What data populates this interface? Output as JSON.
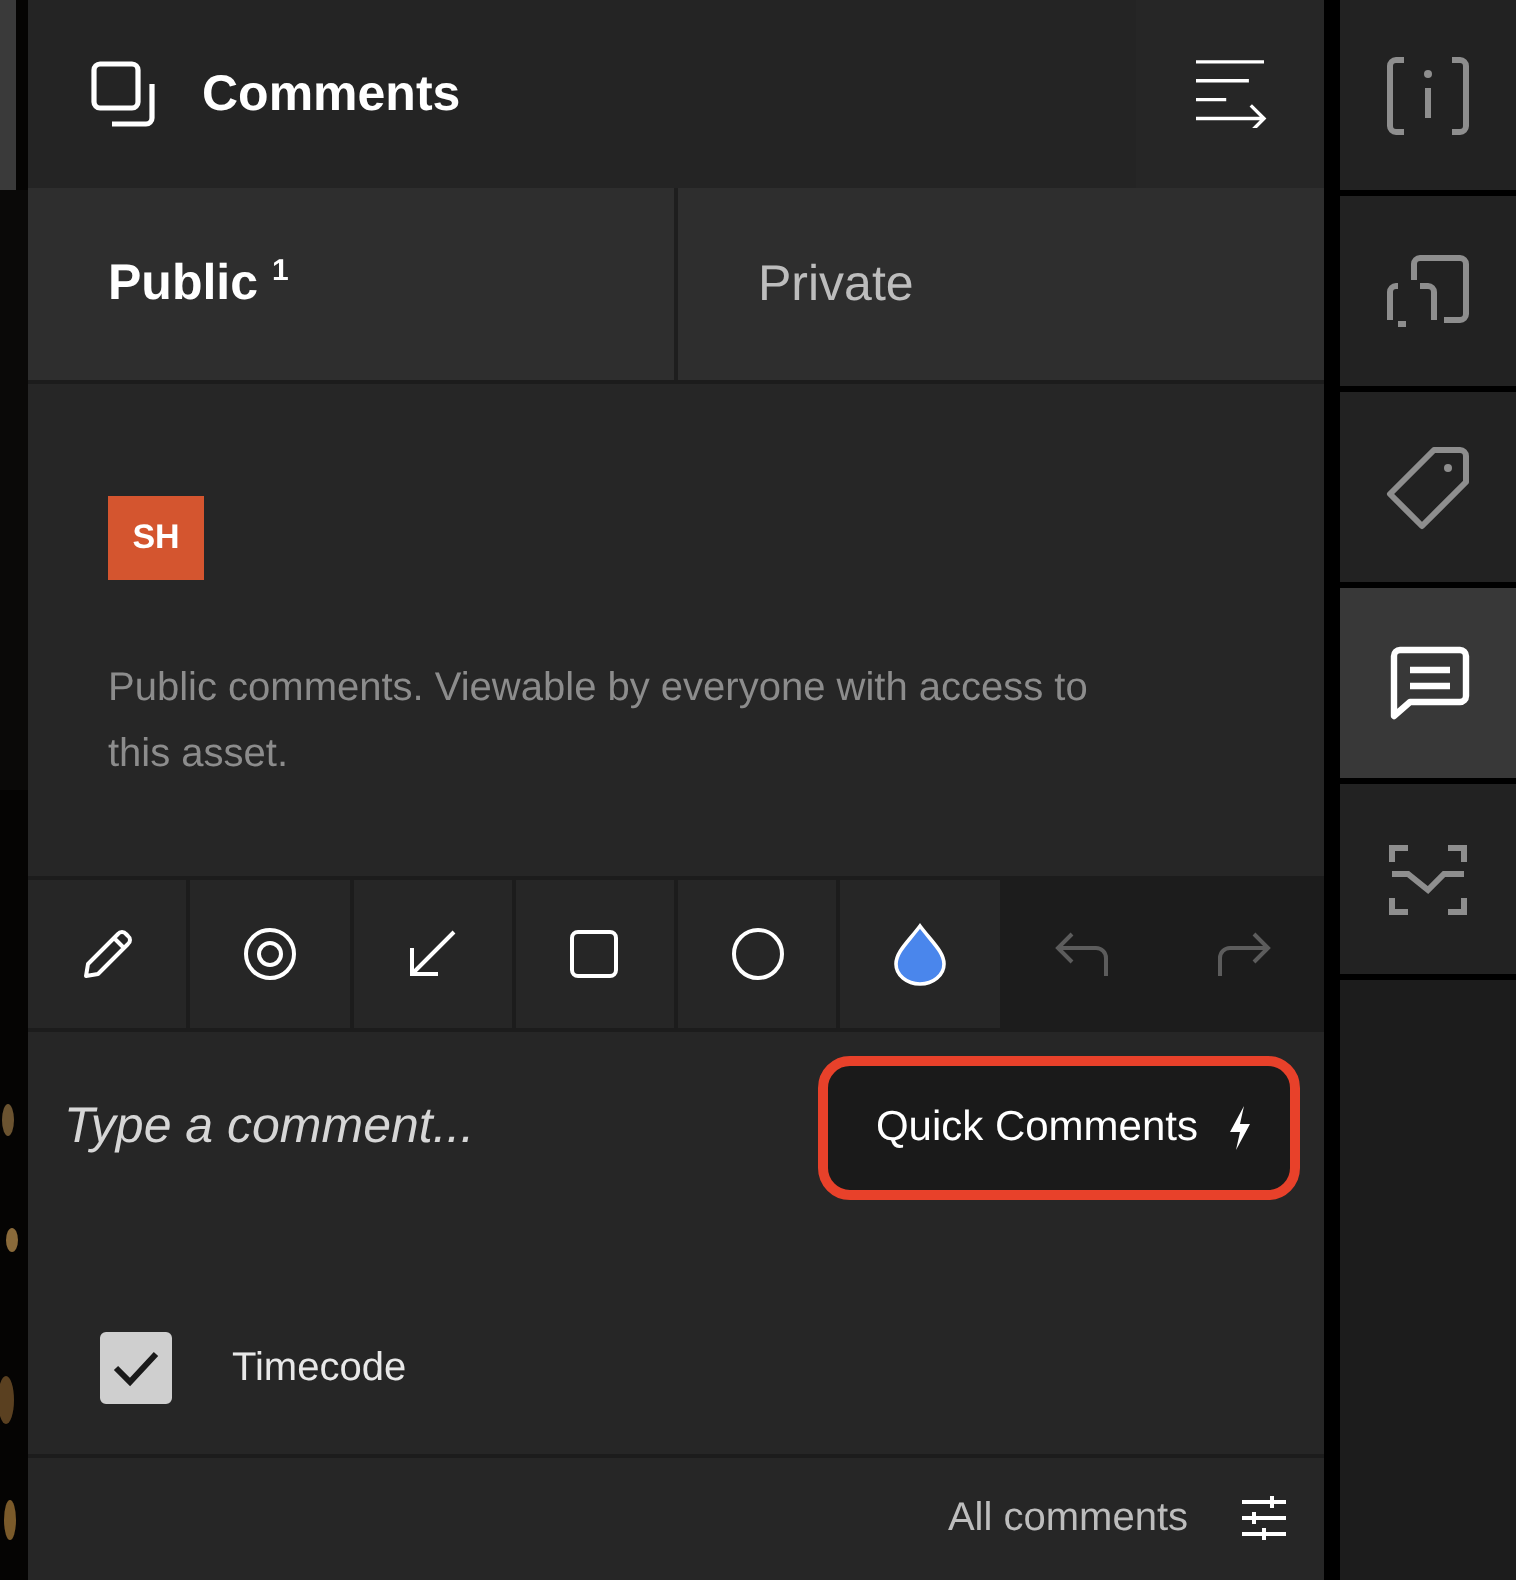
{
  "header": {
    "title": "Comments"
  },
  "tabs": [
    {
      "label": "Public $^{1}$",
      "selected": true
    },
    {
      "label": "Private",
      "selected": false
    }
  ],
  "author": {
    "initials": "SH"
  },
  "note": "Public comments. Viewable by everyone with access to this asset.",
  "tools": [
    {
      "kind": "pencil",
      "disabled": false
    },
    {
      "kind": "target",
      "disabled": false
    },
    {
      "kind": "arrow",
      "disabled": false
    },
    {
      "kind": "rectangle",
      "disabled": false
    },
    {
      "kind": "ellipse",
      "disabled": false
    },
    {
      "kind": "color",
      "disabled": false,
      "color": "#4a86ec"
    },
    {
      "kind": "undo",
      "disabled": true
    },
    {
      "kind": "redo",
      "disabled": true
    }
  ],
  "comment": {
    "placeholder": "Type a comment..."
  },
  "quick_comments": {
    "label": "Quick Comments"
  },
  "timecode": {
    "label": "Timecode",
    "checked": true
  },
  "footer": {
    "filter": "All comments"
  },
  "rail": [
    {
      "kind": "info",
      "selected": false
    },
    {
      "kind": "frame",
      "selected": false
    },
    {
      "kind": "tag",
      "selected": false
    },
    {
      "kind": "comments",
      "selected": true
    },
    {
      "kind": "waveform",
      "selected": false
    }
  ]
}
